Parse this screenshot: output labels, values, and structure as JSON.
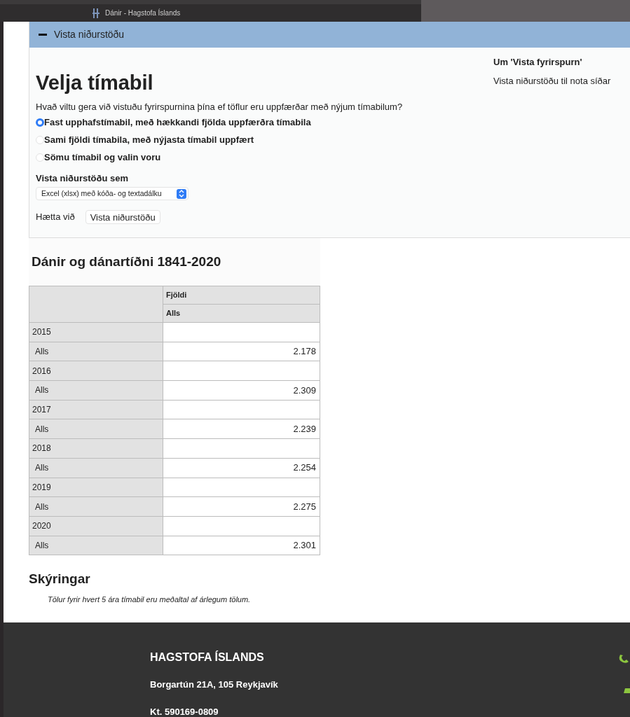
{
  "browser_tab": {
    "title": "Dánir - Hagstofa Íslands"
  },
  "panel": {
    "header": "Vista niðurstöðu",
    "expanded": true,
    "title": "Velja tímabil",
    "question": "Hvað viltu gera við vistuðu fyrirspurnina þína ef töflur eru uppfærðar með nýjum tímabilum?",
    "options": [
      {
        "label": "Fast upphafstímabil, með hækkandi fjölda uppfærðra tímabila",
        "selected": true
      },
      {
        "label": "Sami fjöldi tímabila, með nýjasta tímabil uppfært",
        "selected": false
      },
      {
        "label": "Sömu tímabil og valin voru",
        "selected": false
      }
    ],
    "format_label": "Vista niðurstöðu sem",
    "format_value": "Excel (xlsx) með kóða- og textadálku",
    "cancel": "Hætta við",
    "save": "Vista niðurstöðu",
    "aside_title": "Um 'Vista fyrirspurn'",
    "aside_text": "Vista niðurstöðu til nota síðar"
  },
  "table": {
    "title": "Dánir og dánartíðni 1841-2020",
    "header_1": "Fjöldi",
    "header_2": "Alls",
    "rows": [
      {
        "year": "2015",
        "label": "Alls",
        "value": "2.178"
      },
      {
        "year": "2016",
        "label": "Alls",
        "value": "2.309"
      },
      {
        "year": "2017",
        "label": "Alls",
        "value": "2.239"
      },
      {
        "year": "2018",
        "label": "Alls",
        "value": "2.254"
      },
      {
        "year": "2019",
        "label": "Alls",
        "value": "2.275"
      },
      {
        "year": "2020",
        "label": "Alls",
        "value": "2.301"
      }
    ]
  },
  "notes": {
    "title": "Skýringar",
    "text": "Tölur fyrir hvert 5 ára tímabil eru meðaltal af árlegum tölum."
  },
  "footer": {
    "name": "HAGSTOFA ÍSLANDS",
    "address": "Borgartún 21A, 105 Reykjavík",
    "id": "Kt. 590169-0809"
  }
}
